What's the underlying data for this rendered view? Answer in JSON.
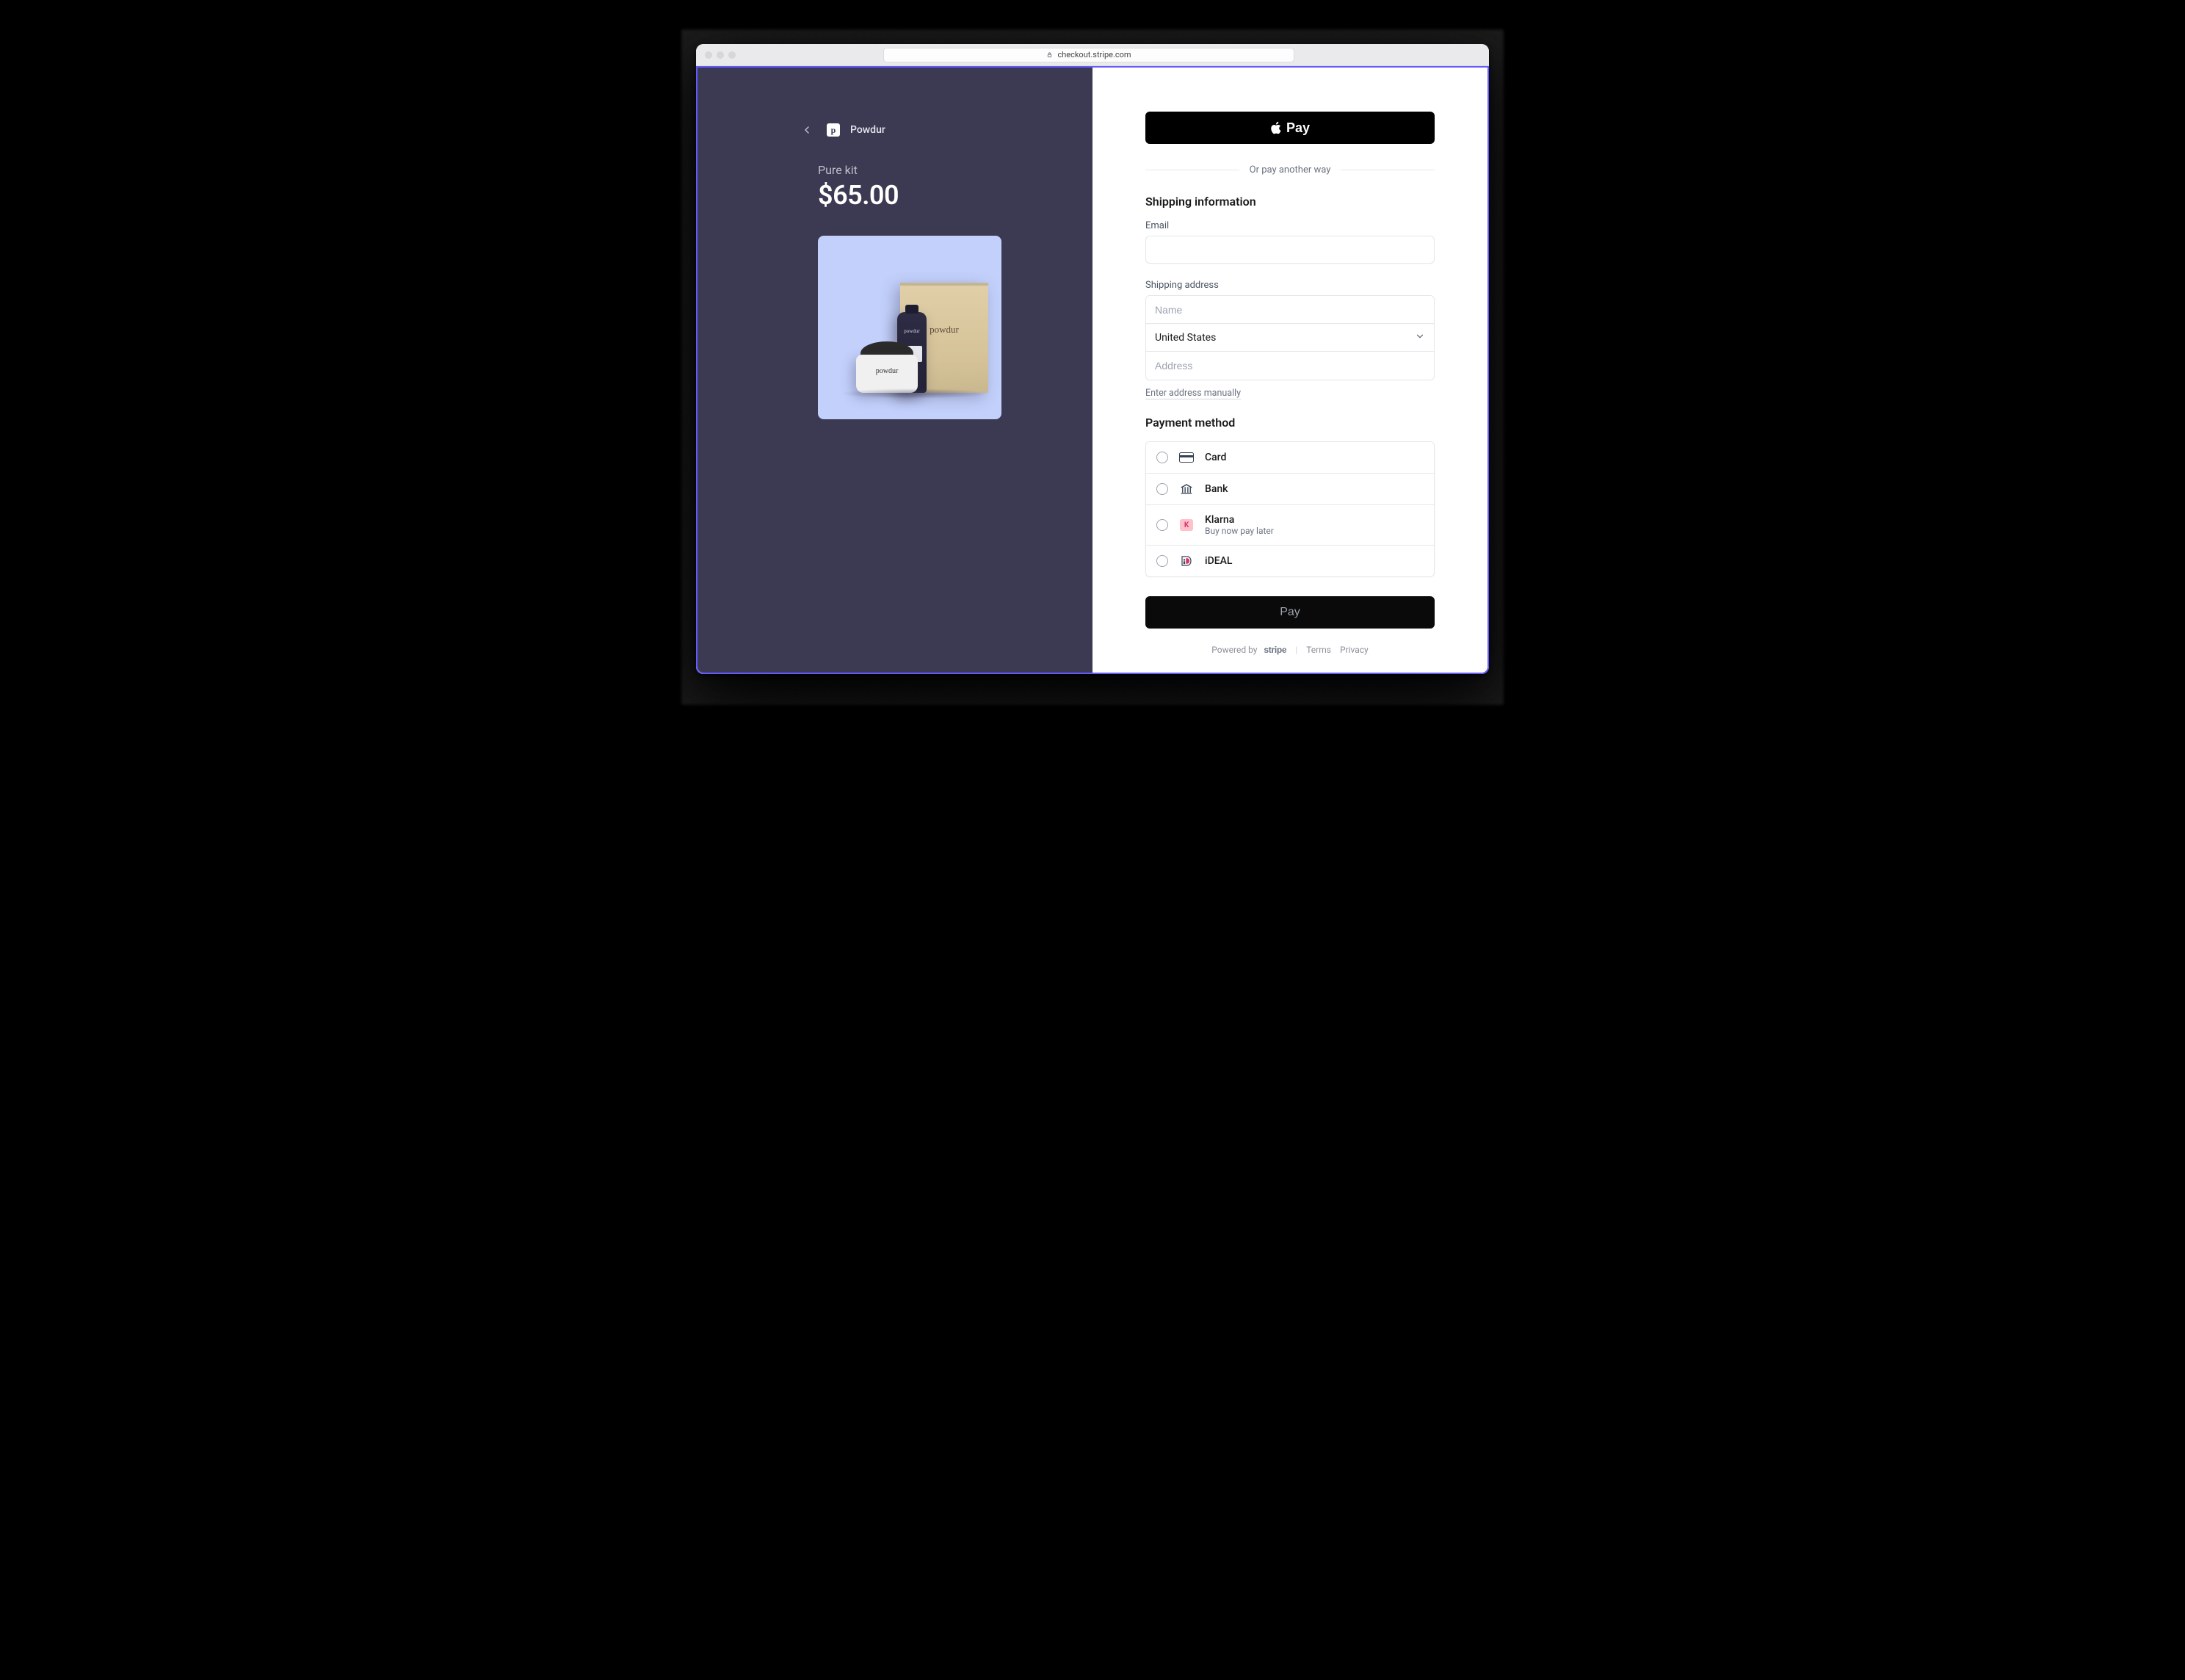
{
  "browser": {
    "url": "checkout.stripe.com"
  },
  "merchant": {
    "name": "Powdur",
    "mark_letter": "p"
  },
  "product": {
    "title": "Pure kit",
    "price": "$65.00",
    "box_label": "powdur",
    "tube_label": "powdur",
    "tube_sub": "",
    "jar_label": "powdur"
  },
  "express": {
    "apple_pay_label": "Pay",
    "divider_text": "Or pay another way"
  },
  "shipping": {
    "heading": "Shipping information",
    "email_label": "Email",
    "email_value": "",
    "address_label": "Shipping address",
    "name_placeholder": "Name",
    "name_value": "",
    "country_value": "United States",
    "address_placeholder": "Address",
    "address_value": "",
    "manual_link": "Enter address manually"
  },
  "payment": {
    "heading": "Payment method",
    "methods": [
      {
        "key": "card",
        "label": "Card",
        "sub": ""
      },
      {
        "key": "bank",
        "label": "Bank",
        "sub": ""
      },
      {
        "key": "klarna",
        "label": "Klarna",
        "sub": "Buy now pay later"
      },
      {
        "key": "ideal",
        "label": "iDEAL",
        "sub": ""
      }
    ]
  },
  "cta": {
    "pay_label": "Pay"
  },
  "footer": {
    "powered_by": "Powered by",
    "brand": "stripe",
    "terms": "Terms",
    "privacy": "Privacy"
  },
  "colors": {
    "accent": "#635bff",
    "left_bg": "#3c3a52",
    "klarna_bg": "#ffc0cb",
    "klarna_fg": "#d6336c"
  }
}
